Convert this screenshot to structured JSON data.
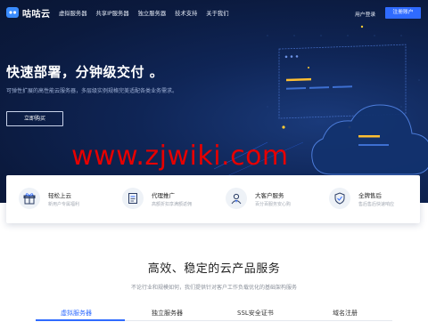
{
  "brand": {
    "name": "咕咕云"
  },
  "nav": {
    "items": [
      "虚拟服务器",
      "共享IP服务器",
      "独立服务器",
      "技术支持",
      "关于我们"
    ],
    "login_label": "用户登录",
    "register_label": "注册账户"
  },
  "hero": {
    "title": "快速部署，分钟级交付 。",
    "subtitle": "可弹性扩展的高性能云服务器，多层级实例规格完美适配各类业务需求。",
    "cta_label": "立即购买"
  },
  "watermark": "www.zjwiki.com",
  "features": [
    {
      "title": "轻松上云",
      "desc": "新用户专属福利"
    },
    {
      "title": "代理推广",
      "desc": "高额折扣享满额返佣"
    },
    {
      "title": "大客户服务",
      "desc": "百分百服务安心购"
    },
    {
      "title": "全牌售后",
      "desc": "售后售后快速响应"
    }
  ],
  "products": {
    "title": "高效、稳定的云产品服务",
    "subtitle": "不论行业和规模如何，我们提供针对客户工作负载优化的基础架构服务",
    "tabs": [
      "虚拟服务器",
      "独立服务器",
      "SSL安全证书",
      "域名注册"
    ],
    "active_tab": 0
  },
  "colors": {
    "accent": "#2f6bff",
    "hero_bg": "#0b1a3e",
    "watermark": "#e60000"
  }
}
